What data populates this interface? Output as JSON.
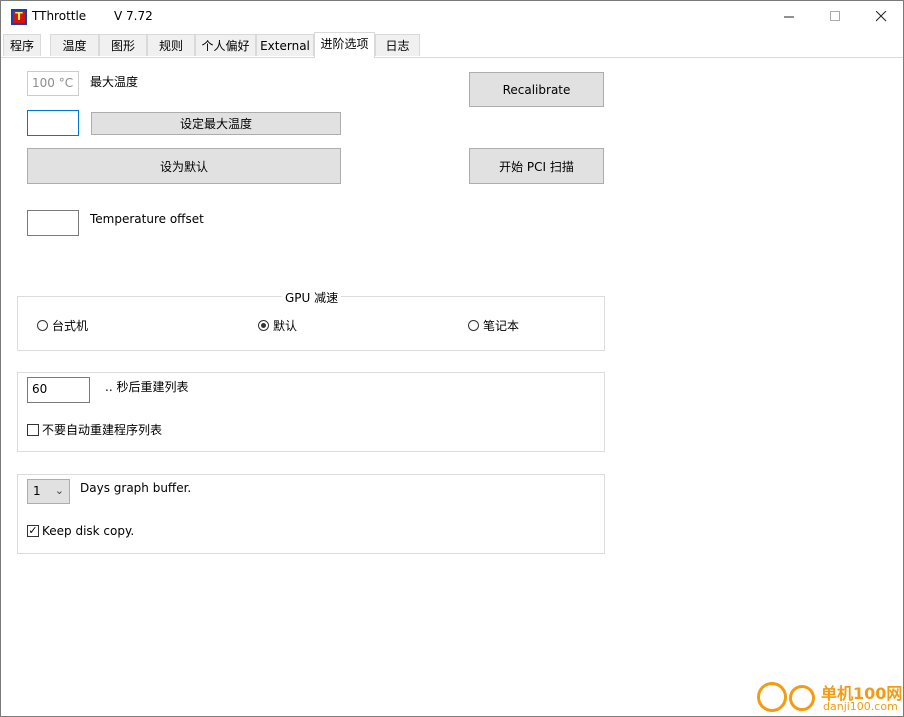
{
  "window": {
    "title": "TThrottle",
    "version": "V 7.72"
  },
  "tabs": [
    {
      "label": "程序"
    },
    {
      "label": "温度"
    },
    {
      "label": "图形"
    },
    {
      "label": "规则"
    },
    {
      "label": "个人偏好"
    },
    {
      "label": "External"
    },
    {
      "label": "进阶选项",
      "active": true
    },
    {
      "label": "日志"
    }
  ],
  "max_temp": {
    "value": "100 °C",
    "label": "最大温度",
    "set_button": "设定最大温度",
    "input_value": ""
  },
  "default_button": "设为默认",
  "recalibrate_button": "Recalibrate",
  "pci_scan_button": "开始 PCI 扫描",
  "temp_offset": {
    "label": "Temperature offset",
    "value": ""
  },
  "gpu": {
    "title": "GPU 减速",
    "options": [
      "台式机",
      "默认",
      "笔记本"
    ],
    "selected": "默认"
  },
  "rebuild": {
    "seconds": "60",
    "label": ".. 秒后重建列表",
    "auto_label": "不要自动重建程序列表",
    "auto_checked": false
  },
  "graph": {
    "days": "1",
    "label": "Days graph buffer.",
    "keep_label": "Keep disk copy.",
    "keep_checked": true
  },
  "watermark": {
    "text": "单机100网",
    "url": "danji100.com"
  },
  "colors": {
    "focus_border": "#0078d7",
    "button_bg": "#e1e1e1",
    "watermark": "#f39c12"
  }
}
